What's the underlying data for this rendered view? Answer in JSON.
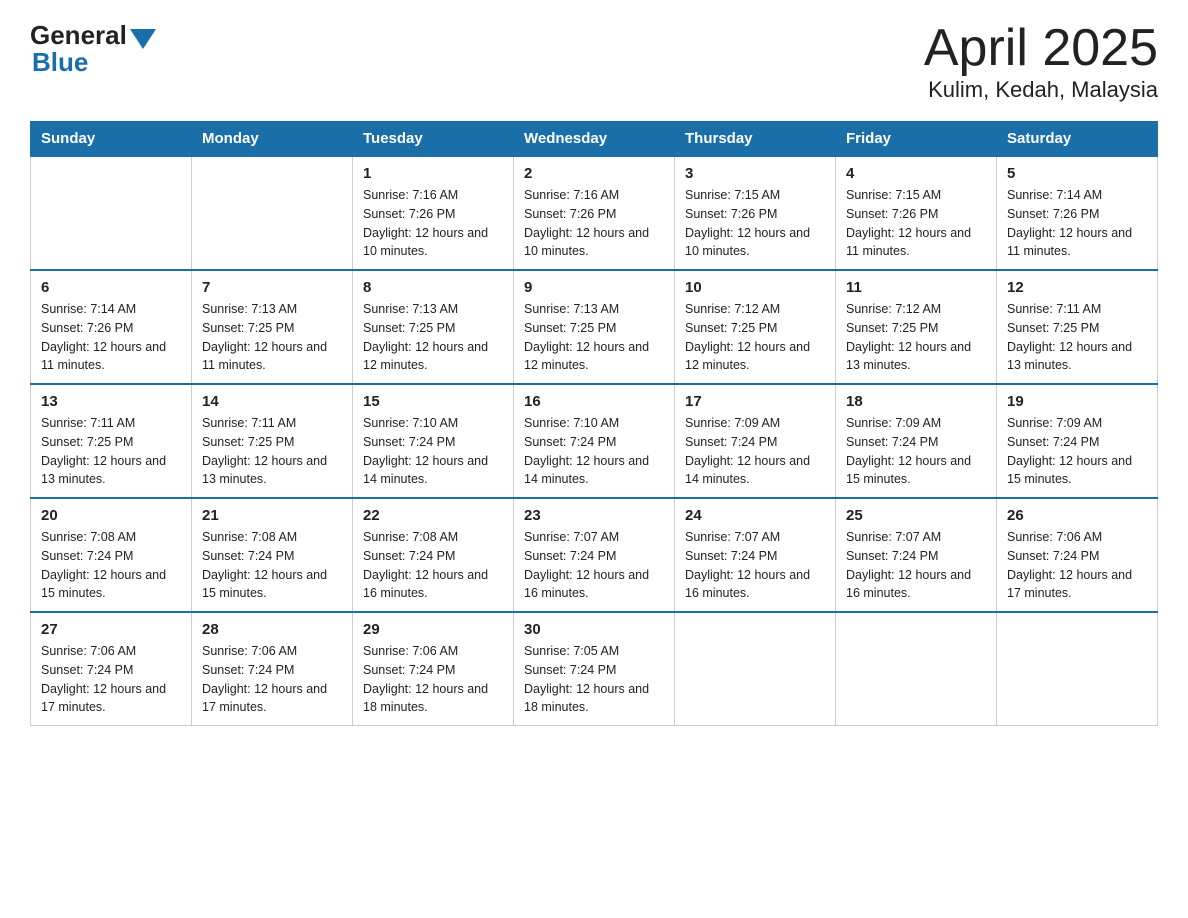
{
  "header": {
    "logo": {
      "general": "General",
      "triangle": "▲",
      "blue": "Blue"
    },
    "title": "April 2025",
    "subtitle": "Kulim, Kedah, Malaysia"
  },
  "weekdays": [
    "Sunday",
    "Monday",
    "Tuesday",
    "Wednesday",
    "Thursday",
    "Friday",
    "Saturday"
  ],
  "weeks": [
    [
      {
        "day": "",
        "sunrise": "",
        "sunset": "",
        "daylight": ""
      },
      {
        "day": "",
        "sunrise": "",
        "sunset": "",
        "daylight": ""
      },
      {
        "day": "1",
        "sunrise": "Sunrise: 7:16 AM",
        "sunset": "Sunset: 7:26 PM",
        "daylight": "Daylight: 12 hours and 10 minutes."
      },
      {
        "day": "2",
        "sunrise": "Sunrise: 7:16 AM",
        "sunset": "Sunset: 7:26 PM",
        "daylight": "Daylight: 12 hours and 10 minutes."
      },
      {
        "day": "3",
        "sunrise": "Sunrise: 7:15 AM",
        "sunset": "Sunset: 7:26 PM",
        "daylight": "Daylight: 12 hours and 10 minutes."
      },
      {
        "day": "4",
        "sunrise": "Sunrise: 7:15 AM",
        "sunset": "Sunset: 7:26 PM",
        "daylight": "Daylight: 12 hours and 11 minutes."
      },
      {
        "day": "5",
        "sunrise": "Sunrise: 7:14 AM",
        "sunset": "Sunset: 7:26 PM",
        "daylight": "Daylight: 12 hours and 11 minutes."
      }
    ],
    [
      {
        "day": "6",
        "sunrise": "Sunrise: 7:14 AM",
        "sunset": "Sunset: 7:26 PM",
        "daylight": "Daylight: 12 hours and 11 minutes."
      },
      {
        "day": "7",
        "sunrise": "Sunrise: 7:13 AM",
        "sunset": "Sunset: 7:25 PM",
        "daylight": "Daylight: 12 hours and 11 minutes."
      },
      {
        "day": "8",
        "sunrise": "Sunrise: 7:13 AM",
        "sunset": "Sunset: 7:25 PM",
        "daylight": "Daylight: 12 hours and 12 minutes."
      },
      {
        "day": "9",
        "sunrise": "Sunrise: 7:13 AM",
        "sunset": "Sunset: 7:25 PM",
        "daylight": "Daylight: 12 hours and 12 minutes."
      },
      {
        "day": "10",
        "sunrise": "Sunrise: 7:12 AM",
        "sunset": "Sunset: 7:25 PM",
        "daylight": "Daylight: 12 hours and 12 minutes."
      },
      {
        "day": "11",
        "sunrise": "Sunrise: 7:12 AM",
        "sunset": "Sunset: 7:25 PM",
        "daylight": "Daylight: 12 hours and 13 minutes."
      },
      {
        "day": "12",
        "sunrise": "Sunrise: 7:11 AM",
        "sunset": "Sunset: 7:25 PM",
        "daylight": "Daylight: 12 hours and 13 minutes."
      }
    ],
    [
      {
        "day": "13",
        "sunrise": "Sunrise: 7:11 AM",
        "sunset": "Sunset: 7:25 PM",
        "daylight": "Daylight: 12 hours and 13 minutes."
      },
      {
        "day": "14",
        "sunrise": "Sunrise: 7:11 AM",
        "sunset": "Sunset: 7:25 PM",
        "daylight": "Daylight: 12 hours and 13 minutes."
      },
      {
        "day": "15",
        "sunrise": "Sunrise: 7:10 AM",
        "sunset": "Sunset: 7:24 PM",
        "daylight": "Daylight: 12 hours and 14 minutes."
      },
      {
        "day": "16",
        "sunrise": "Sunrise: 7:10 AM",
        "sunset": "Sunset: 7:24 PM",
        "daylight": "Daylight: 12 hours and 14 minutes."
      },
      {
        "day": "17",
        "sunrise": "Sunrise: 7:09 AM",
        "sunset": "Sunset: 7:24 PM",
        "daylight": "Daylight: 12 hours and 14 minutes."
      },
      {
        "day": "18",
        "sunrise": "Sunrise: 7:09 AM",
        "sunset": "Sunset: 7:24 PM",
        "daylight": "Daylight: 12 hours and 15 minutes."
      },
      {
        "day": "19",
        "sunrise": "Sunrise: 7:09 AM",
        "sunset": "Sunset: 7:24 PM",
        "daylight": "Daylight: 12 hours and 15 minutes."
      }
    ],
    [
      {
        "day": "20",
        "sunrise": "Sunrise: 7:08 AM",
        "sunset": "Sunset: 7:24 PM",
        "daylight": "Daylight: 12 hours and 15 minutes."
      },
      {
        "day": "21",
        "sunrise": "Sunrise: 7:08 AM",
        "sunset": "Sunset: 7:24 PM",
        "daylight": "Daylight: 12 hours and 15 minutes."
      },
      {
        "day": "22",
        "sunrise": "Sunrise: 7:08 AM",
        "sunset": "Sunset: 7:24 PM",
        "daylight": "Daylight: 12 hours and 16 minutes."
      },
      {
        "day": "23",
        "sunrise": "Sunrise: 7:07 AM",
        "sunset": "Sunset: 7:24 PM",
        "daylight": "Daylight: 12 hours and 16 minutes."
      },
      {
        "day": "24",
        "sunrise": "Sunrise: 7:07 AM",
        "sunset": "Sunset: 7:24 PM",
        "daylight": "Daylight: 12 hours and 16 minutes."
      },
      {
        "day": "25",
        "sunrise": "Sunrise: 7:07 AM",
        "sunset": "Sunset: 7:24 PM",
        "daylight": "Daylight: 12 hours and 16 minutes."
      },
      {
        "day": "26",
        "sunrise": "Sunrise: 7:06 AM",
        "sunset": "Sunset: 7:24 PM",
        "daylight": "Daylight: 12 hours and 17 minutes."
      }
    ],
    [
      {
        "day": "27",
        "sunrise": "Sunrise: 7:06 AM",
        "sunset": "Sunset: 7:24 PM",
        "daylight": "Daylight: 12 hours and 17 minutes."
      },
      {
        "day": "28",
        "sunrise": "Sunrise: 7:06 AM",
        "sunset": "Sunset: 7:24 PM",
        "daylight": "Daylight: 12 hours and 17 minutes."
      },
      {
        "day": "29",
        "sunrise": "Sunrise: 7:06 AM",
        "sunset": "Sunset: 7:24 PM",
        "daylight": "Daylight: 12 hours and 18 minutes."
      },
      {
        "day": "30",
        "sunrise": "Sunrise: 7:05 AM",
        "sunset": "Sunset: 7:24 PM",
        "daylight": "Daylight: 12 hours and 18 minutes."
      },
      {
        "day": "",
        "sunrise": "",
        "sunset": "",
        "daylight": ""
      },
      {
        "day": "",
        "sunrise": "",
        "sunset": "",
        "daylight": ""
      },
      {
        "day": "",
        "sunrise": "",
        "sunset": "",
        "daylight": ""
      }
    ]
  ]
}
